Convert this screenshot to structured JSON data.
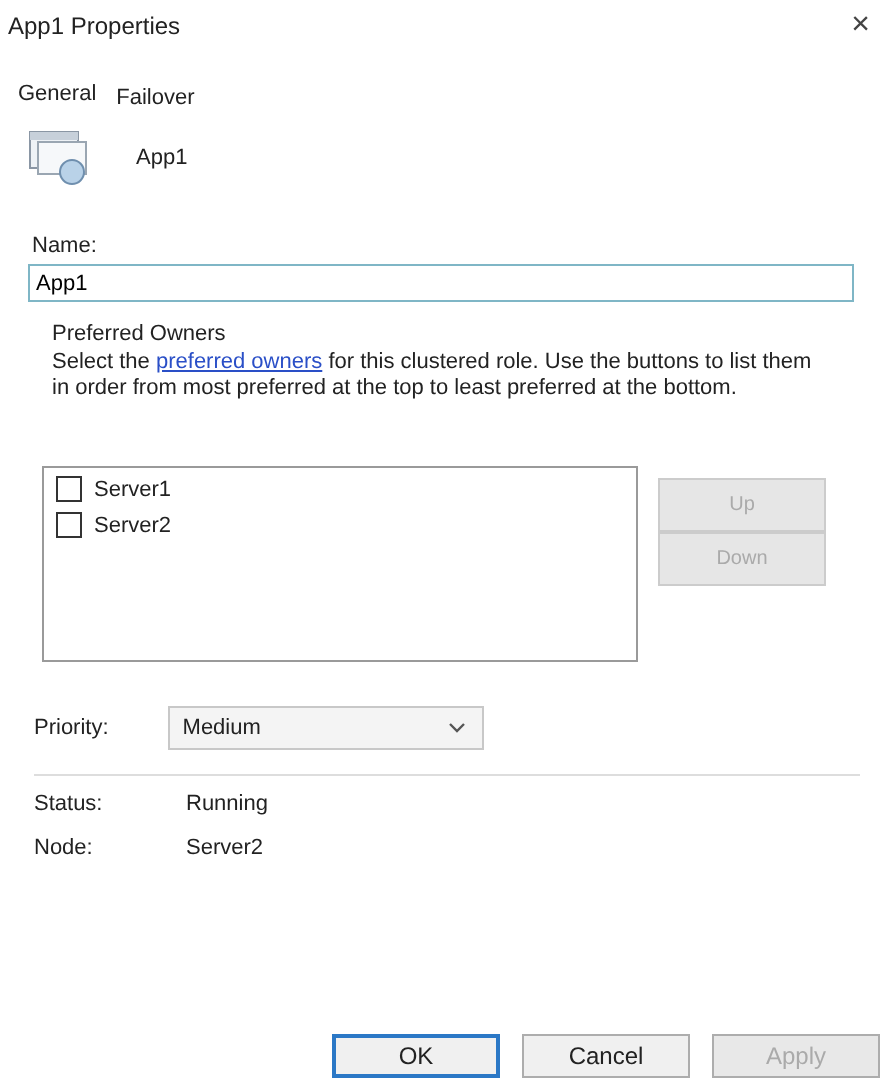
{
  "window": {
    "title": "App1 Properties",
    "close": "×"
  },
  "tabs": [
    {
      "label": "General",
      "selected": true
    },
    {
      "label": "Failover",
      "selected": false
    }
  ],
  "role": {
    "name": "App1"
  },
  "name_field": {
    "label": "Name:",
    "value": "App1"
  },
  "preferred_owners": {
    "heading": "Preferred Owners",
    "text_before": "Select the ",
    "link": "preferred owners",
    "text_after": " for this clustered role. Use the buttons to list them in order from most preferred at the top to least preferred at the bottom.",
    "owners": [
      {
        "label": "Server1",
        "checked": false
      },
      {
        "label": "Server2",
        "checked": false
      }
    ],
    "buttons": [
      {
        "label": "Up",
        "disabled": true
      },
      {
        "label": "Down",
        "disabled": true
      }
    ]
  },
  "priority": {
    "label": "Priority:",
    "value": "Medium"
  },
  "details": [
    {
      "label": "Status:",
      "value": "Running"
    },
    {
      "label": "Node:",
      "value": "Server2"
    }
  ],
  "footer_buttons": [
    {
      "label": "OK",
      "default": true,
      "disabled": false
    },
    {
      "label": "Cancel",
      "default": false,
      "disabled": false
    },
    {
      "label": "Apply",
      "default": false,
      "disabled": true
    }
  ]
}
